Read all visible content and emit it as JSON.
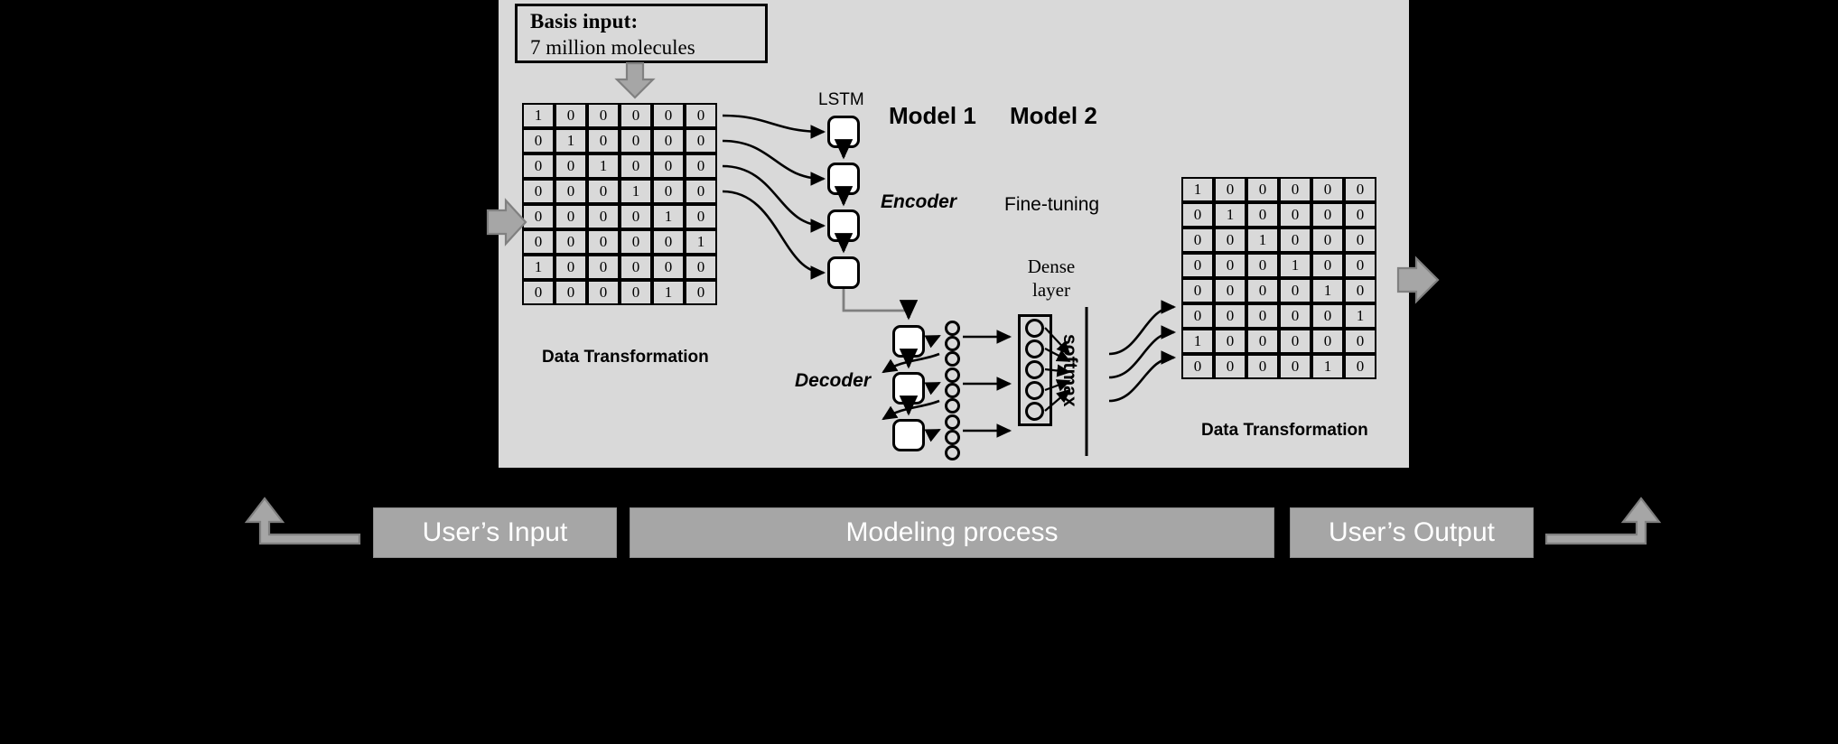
{
  "basis": {
    "title": "Basis input:",
    "subtitle": "7 million  molecules"
  },
  "left_matrix": {
    "label": "Data Transformation",
    "rows": [
      [
        1,
        0,
        0,
        0,
        0,
        0
      ],
      [
        0,
        1,
        0,
        0,
        0,
        0
      ],
      [
        0,
        0,
        1,
        0,
        0,
        0
      ],
      [
        0,
        0,
        0,
        1,
        0,
        0
      ],
      [
        0,
        0,
        0,
        0,
        1,
        0
      ],
      [
        0,
        0,
        0,
        0,
        0,
        1
      ],
      [
        1,
        0,
        0,
        0,
        0,
        0
      ],
      [
        0,
        0,
        0,
        0,
        1,
        0
      ]
    ]
  },
  "right_matrix": {
    "label": "Data Transformation",
    "rows": [
      [
        1,
        0,
        0,
        0,
        0,
        0
      ],
      [
        0,
        1,
        0,
        0,
        0,
        0
      ],
      [
        0,
        0,
        1,
        0,
        0,
        0
      ],
      [
        0,
        0,
        0,
        1,
        0,
        0
      ],
      [
        0,
        0,
        0,
        0,
        1,
        0
      ],
      [
        0,
        0,
        0,
        0,
        0,
        1
      ],
      [
        1,
        0,
        0,
        0,
        0,
        0
      ],
      [
        0,
        0,
        0,
        0,
        1,
        0
      ]
    ]
  },
  "model1": {
    "title": "Model 1",
    "lstm_label": "LSTM",
    "encoder_label": "Encoder",
    "decoder_label": "Decoder",
    "encoder_cells": 4,
    "decoder_cells": 3
  },
  "model2": {
    "title": "Model 2",
    "finetuning_label": "Fine-tuning",
    "dense_label": "Dense layer",
    "dense_label_line1": "Dense",
    "dense_label_line2": "layer",
    "softmax_label": "softmax",
    "dense_nodes": 5
  },
  "bottom_bars": {
    "input": "User’s Input",
    "modeling": "Modeling   process",
    "output": "User’s Output"
  },
  "colors": {
    "background": "#000000",
    "panel": "#d9d9d9",
    "bar": "#a6a6a6",
    "bar_text": "#ffffff",
    "arrow_gray": "#a6a6a6",
    "arrow_gray_stroke": "#808080",
    "stroke": "#000000",
    "cell_fill": "#d9d9d9",
    "lstm_fill": "#ffffff"
  },
  "icons": {
    "input_arrow": "arrow-right-icon",
    "output_arrow": "arrow-right-icon",
    "basis_arrow": "arrow-down-icon",
    "return_left": "elbow-arrow-up-icon",
    "return_right": "elbow-arrow-up-icon"
  }
}
